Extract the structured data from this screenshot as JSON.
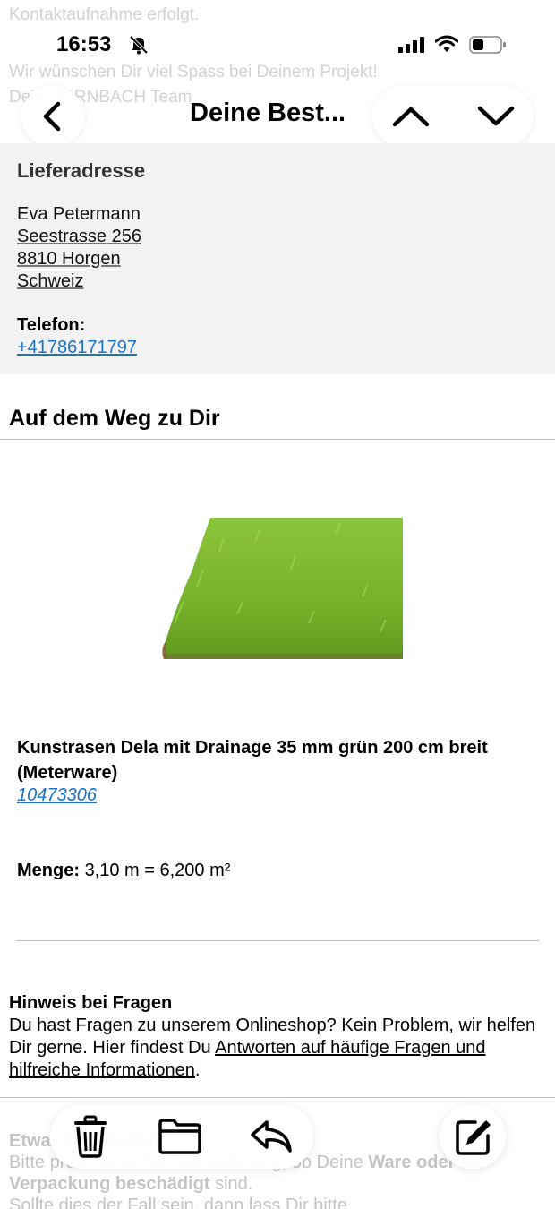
{
  "status_bar": {
    "time": "16:53"
  },
  "background_text": {
    "line1": "Kontaktaufnahme erfolgt.",
    "line2": "Wir wünschen Dir viel Spass bei Deinem Projekt!",
    "line3": "Dein HORNBACH Team"
  },
  "nav": {
    "title": "Deine Best..."
  },
  "delivery": {
    "heading": "Lieferadresse",
    "name": "Eva Petermann",
    "street": "Seestrasse 256",
    "city": "8810 Horgen",
    "country": "Schweiz",
    "phone_label": "Telefon:",
    "phone": "+41786171797"
  },
  "shipping": {
    "heading": "Auf dem Weg zu Dir"
  },
  "product": {
    "name": "Kunstrasen Dela mit Drainage 35 mm grün 200 cm breit (Meterware)",
    "sku": "10473306",
    "qty_label": "Menge:",
    "qty_value": "3,10 m = 6,200 m²"
  },
  "hint": {
    "title": "Hinweis bei Fragen",
    "text_before": "Du hast Fragen zu unserem Onlineshop? Kein Problem, wir helfen Dir gerne. Hier findest Du ",
    "link": "Antworten auf häufige Fragen und hilfreiche Informationen",
    "text_after": "."
  },
  "damage": {
    "title": "Etwas beschädigt?",
    "line1_a": "Bitte prüfe bei Erhalt der Lieferung, ob Deine ",
    "line1_b": "Ware oder die",
    "line2_a": "Verpackung beschädigt",
    "line2_b": " sind.",
    "line3": "Sollte dies der Fall sein, dann lass Dir bitte"
  },
  "icons": {
    "back": "chevron-left-icon",
    "up": "chevron-up-icon",
    "down": "chevron-down-icon",
    "trash": "trash-icon",
    "folder": "folder-icon",
    "reply": "reply-icon",
    "compose": "compose-icon"
  },
  "colors": {
    "link": "#1a73c8",
    "panel": "#f2f2f2",
    "grass": "#7cbb2f"
  }
}
